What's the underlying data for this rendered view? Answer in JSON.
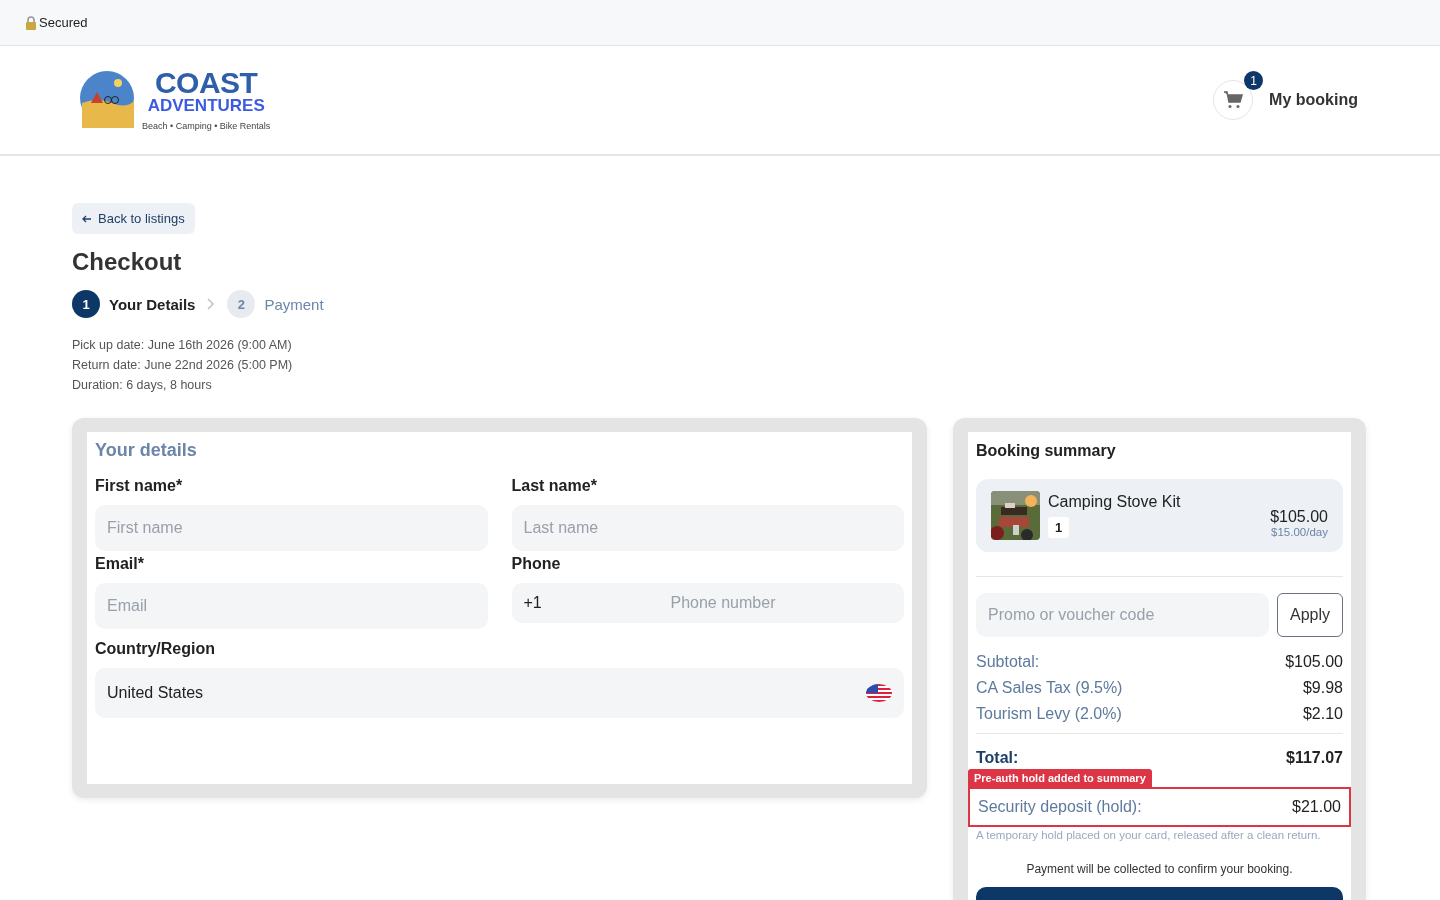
{
  "security_bar": {
    "label": "Secured"
  },
  "header": {
    "brand": {
      "name": "COAST",
      "subtitle": "ADVENTURES",
      "tagline": "Beach • Camping • Bike Rentals"
    },
    "cart": {
      "count": "1",
      "label": "My booking"
    }
  },
  "back_link": "Back to listings",
  "title": "Checkout",
  "steps": [
    {
      "number": "1",
      "label": "Your Details",
      "selected": true
    },
    {
      "number": "2",
      "label": "Payment",
      "selected": false
    }
  ],
  "trip_info": [
    "Pick up date: June 16th 2026 (9:00 AM)",
    "Return date: June 22nd 2026 (5:00 PM)",
    "Duration: 6 days, 8 hours"
  ],
  "details_form": {
    "title": "Your details",
    "fields": [
      {
        "kind": "text",
        "label": "First name*",
        "placeholder": "First name"
      },
      {
        "kind": "text",
        "label": "Last name*",
        "placeholder": "Last name"
      },
      {
        "kind": "text",
        "label": "Email*",
        "placeholder": "Email"
      },
      {
        "kind": "phone",
        "label": "Phone",
        "prefix": "+1",
        "placeholder": "Phone number"
      },
      {
        "kind": "country",
        "label": "Country/Region",
        "value": "United States"
      }
    ]
  },
  "summary": {
    "title": "Booking summary",
    "items": [
      {
        "name": "Camping Stove Kit",
        "quantity": "1",
        "price": "$105.00",
        "rate": "$15.00/day"
      }
    ],
    "promo": {
      "placeholder": "Promo or voucher code",
      "button": "Apply"
    },
    "lines": [
      {
        "label": "Subtotal:",
        "amount": "$105.00"
      },
      {
        "label": "CA Sales Tax (9.5%)",
        "amount": "$9.98"
      },
      {
        "label": "Tourism Levy (2.0%)",
        "amount": "$2.10"
      }
    ],
    "total": {
      "label": "Total:",
      "amount": "$117.07"
    },
    "annotation": "Pre-auth hold added to summary",
    "deposit": {
      "label": "Security deposit (hold):",
      "amount": "$21.00",
      "highlighted": true
    },
    "deposit_note": "A temporary hold placed on your card, released after a clean return.",
    "payment_note": "Payment will be collected to confirm your booking."
  }
}
